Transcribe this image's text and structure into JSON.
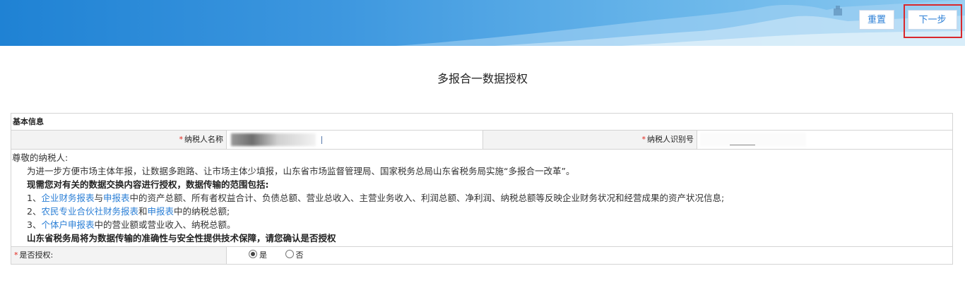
{
  "header": {
    "reset_label": "重置",
    "next_label": "下一步",
    "banner_color": "#2e8bdb",
    "highlight_color": "#d9282c"
  },
  "page_title": "多报合一数据授权",
  "section": {
    "title": "基本信息",
    "required_mark": "*",
    "taxpayer_name_label": "纳税人名称",
    "taxpayer_id_label": "纳税人识别号"
  },
  "notice": {
    "greeting": "尊敬的纳税人:",
    "intro": "为进一步方便市场主体年报，让数据多跑路、让市场主体少填报，山东省市场监督管理局、国家税务总局山东省税务局实施“多报合一改革”。",
    "scope_heading": "现需您对有关的数据交换内容进行授权，数据传输的范围包括:",
    "item1": {
      "prefix": "1、",
      "link1": "企业财务报表",
      "mid1": "与",
      "link2": "申报表",
      "rest": "中的资产总额、所有者权益合计、负债总额、营业总收入、主营业务收入、利润总额、净利润、纳税总额等反映企业财务状况和经营成果的资产状况信息;"
    },
    "item2": {
      "prefix": "2、",
      "link1": "农民专业合伙社财务报表",
      "mid1": "和",
      "link2": "申报表",
      "rest": "中的纳税总额;"
    },
    "item3": {
      "prefix": "3、",
      "link1": "个体户申报表",
      "rest": "中的营业额或营业收入、纳税总额。"
    },
    "guarantee": "山东省税务局将为数据传输的准确性与安全性提供技术保障，请您确认是否授权"
  },
  "authorize": {
    "label": "是否授权:",
    "option_yes": "是",
    "option_no": "否",
    "selected": "是"
  }
}
